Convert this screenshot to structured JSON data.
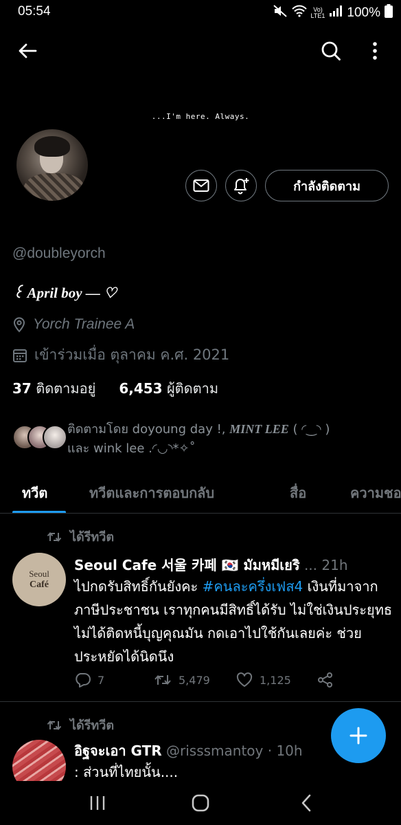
{
  "status_bar": {
    "time": "05:54",
    "network_top": "Vo)",
    "network_bottom": "LTE1",
    "battery": "100%"
  },
  "header": {
    "bio_header": "...I'm here. Always."
  },
  "profile": {
    "handle": "@doubleyorch",
    "bio": "꒰ April boy — ♡",
    "location": "Yorch Trainee A",
    "joined": "เข้าร่วมเมื่อ ตุลาคม ค.ศ. 2021",
    "following_count": "37",
    "following_label": "ติดตามอยู่",
    "followers_count": "6,453",
    "followers_label": "ผู้ติดตาม",
    "follow_button": "กำลังติดตาม",
    "followed_by_prefix": "ติดตามโดย doyoung day !,",
    "followed_by_name2": "MINT LEE",
    "followed_by_name2_suffix": " ( ◜‿◝ )",
    "followed_by_line2": "และ wink lee .◜◡◝*✧˚"
  },
  "tabs": [
    "ทวีต",
    "ทวีตและการตอบกลับ",
    "สื่อ",
    "ความชอบ"
  ],
  "tweets": [
    {
      "retweet_label": "ได้รีทวีต",
      "name": "Seoul Cafe 서울 카페 🇰🇷 มัมหมีเยริ",
      "meta": "... 21h",
      "avatar_text_top": "Seoul",
      "avatar_text_bottom": "Café",
      "text_before": "ไปกดรับสิทธิ์กันยังคะ ",
      "hashtag": "#คนละครึ่งเฟส4",
      "text_after": " เงินที่มาจากภาษีประชาชน เราทุกคนมีสิทธิ์ได้รับ ไม่ใช่เงินประยุทธ ไม่ได้ติดหนี้บุญคุณมัน กดเอาไปใช้กันเลยค่ะ ช่วยประหยัดได้นิดนึง",
      "replies": "7",
      "retweets": "5,479",
      "likes": "1,125"
    },
    {
      "retweet_label": "ได้รีทวีต",
      "name": "อิฐจะเอา GTR",
      "meta": "@risssmantoy · 10h",
      "text": ": ส่วนที่ไทยนั้น...."
    }
  ],
  "colors": {
    "accent": "#1d9bf0",
    "muted": "#71767b",
    "background": "#000000"
  }
}
